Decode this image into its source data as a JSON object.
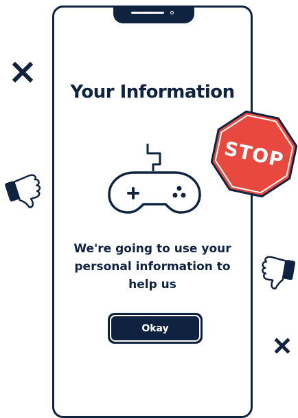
{
  "screen": {
    "title": "Your Information",
    "message_lines": [
      "We're going to use your",
      "personal information to",
      "help us"
    ],
    "primary_button_label": "Okay"
  },
  "decorations": {
    "stop_sign_text": "STOP",
    "icons": [
      "close-x-icon",
      "thumbs-down-icon",
      "stop-sign",
      "game-controller-icon"
    ]
  },
  "colors": {
    "navy": "#0f2340",
    "stop_red": "#e8483d",
    "background": "#ffffff"
  }
}
